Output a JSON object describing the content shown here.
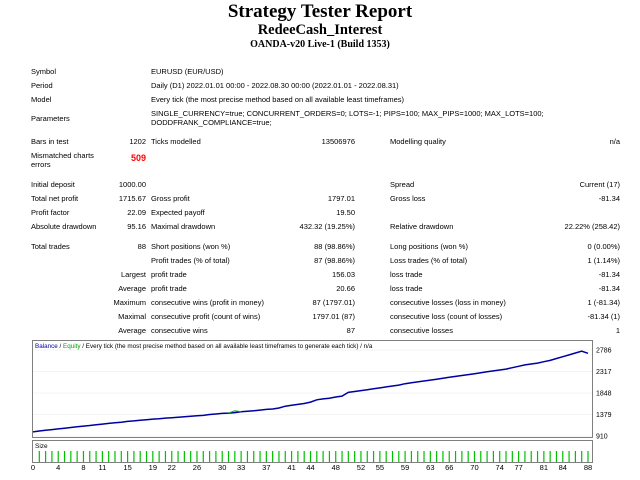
{
  "header": {
    "title": "Strategy Tester Report",
    "ea_name": "RedeeCash_Interest",
    "server": "OANDA-v20 Live-1 (Build 1353)"
  },
  "settings": {
    "symbol_label": "Symbol",
    "symbol": "EURUSD (EUR/USD)",
    "period_label": "Period",
    "period": "Daily (D1) 2022.01.01 00:00 - 2022.08.30 00:00 (2022.01.01 - 2022.08.31)",
    "model_label": "Model",
    "model": "Every tick (the most precise method based on all available least timeframes)",
    "parameters_label": "Parameters",
    "parameters_line1": "SINGLE_CURRENCY=true; CONCURRENT_ORDERS=0; LOTS=-1; PIPS=100; MAX_PIPS=1000; MAX_LOTS=100;",
    "parameters_line2": "DODDFRANK_COMPLIANCE=true;"
  },
  "modelling": {
    "bars_label": "Bars in test",
    "bars": "1202",
    "ticks_label": "Ticks modelled",
    "ticks": "13506976",
    "quality_label": "Modelling quality",
    "quality": "n/a",
    "mismatch_label_1": "Mismatched charts",
    "mismatch_label_2": "errors",
    "mismatch": "509"
  },
  "results": {
    "initial_deposit_label": "Initial deposit",
    "initial_deposit": "1000.00",
    "spread_label": "Spread",
    "spread": "Current (17)",
    "total_net_profit_label": "Total net profit",
    "total_net_profit": "1715.67",
    "gross_profit_label": "Gross profit",
    "gross_profit": "1797.01",
    "gross_loss_label": "Gross loss",
    "gross_loss": "-81.34",
    "profit_factor_label": "Profit factor",
    "profit_factor": "22.09",
    "expected_payoff_label": "Expected payoff",
    "expected_payoff": "19.50",
    "absolute_drawdown_label": "Absolute drawdown",
    "absolute_drawdown": "95.16",
    "maximal_drawdown_label": "Maximal drawdown",
    "maximal_drawdown": "432.32 (19.25%)",
    "relative_drawdown_label": "Relative drawdown",
    "relative_drawdown": "22.22% (258.42)"
  },
  "trades": {
    "total_trades_label": "Total trades",
    "total_trades": "88",
    "short_label": "Short positions (won %)",
    "short": "88 (98.86%)",
    "long_label": "Long positions (won %)",
    "long": "0 (0.00%)",
    "profit_trades_label": "Profit trades (% of total)",
    "profit_trades": "87 (98.86%)",
    "loss_trades_label": "Loss trades (% of total)",
    "loss_trades": "1 (1.14%)",
    "largest_label": "Largest",
    "largest_profit_label": "profit trade",
    "largest_profit": "156.03",
    "largest_loss_label": "loss trade",
    "largest_loss": "-81.34",
    "average_label": "Average",
    "average_profit_label": "profit trade",
    "average_profit": "20.66",
    "average_loss_label": "loss trade",
    "average_loss": "-81.34",
    "maximum_label": "Maximum",
    "max_cons_wins_label": "consecutive wins (profit in money)",
    "max_cons_wins": "87 (1797.01)",
    "max_cons_losses_label": "consecutive losses (loss in money)",
    "max_cons_losses": "1 (-81.34)",
    "maximal_label": "Maximal",
    "maximal_cons_profit_label": "consecutive profit (count of wins)",
    "maximal_cons_profit": "1797.01 (87)",
    "maximal_cons_loss_label": "consecutive loss (count of losses)",
    "maximal_cons_loss": "-81.34 (1)",
    "average2_label": "Average",
    "avg_cons_wins_label": "consecutive wins",
    "avg_cons_wins": "87",
    "avg_cons_losses_label": "consecutive losses",
    "avg_cons_losses": "1"
  },
  "chart_data": {
    "type": "line",
    "legend_balance": "Balance",
    "legend_sep": " / ",
    "legend_equity": "Equity",
    "legend_rest": " / Every tick (the most precise method based on all available least timeframes to generate each tick) / n/a",
    "ylim": [
      910,
      2786
    ],
    "y_ticks": [
      "2786",
      "2317",
      "1848",
      "1379",
      "910"
    ],
    "x_ticks": [
      "0",
      "4",
      "8",
      "11",
      "15",
      "19",
      "22",
      "26",
      "30",
      "33",
      "37",
      "41",
      "44",
      "48",
      "52",
      "55",
      "59",
      "63",
      "66",
      "70",
      "74",
      "77",
      "81",
      "84",
      "88"
    ],
    "size_label": "Size",
    "colors": {
      "balance": "#0000a0",
      "equity": "#00b000",
      "size": "#00c000",
      "frame": "#7f7f7f"
    },
    "balance": [
      1000,
      1020,
      1035,
      1050,
      1064,
      1080,
      1095,
      1112,
      1125,
      1140,
      1156,
      1170,
      1185,
      1200,
      1212,
      1228,
      1240,
      1255,
      1265,
      1278,
      1288,
      1300,
      1310,
      1320,
      1330,
      1340,
      1350,
      1360,
      1378,
      1390,
      1402,
      1410,
      1420,
      1440,
      1450,
      1460,
      1475,
      1490,
      1500,
      1520,
      1560,
      1580,
      1600,
      1620,
      1650,
      1700,
      1720,
      1735,
      1760,
      1780,
      1860,
      1880,
      1900,
      1920,
      1940,
      1960,
      1980,
      2000,
      2020,
      2050,
      2070,
      2090,
      2110,
      2130,
      2150,
      2170,
      2190,
      2210,
      2230,
      2250,
      2270,
      2290,
      2310,
      2330,
      2350,
      2370,
      2400,
      2430,
      2460,
      2480,
      2500,
      2530,
      2560,
      2600,
      2640,
      2680,
      2720,
      2760,
      2715
    ],
    "equity_spike": {
      "x": 32,
      "y": 1460
    }
  }
}
